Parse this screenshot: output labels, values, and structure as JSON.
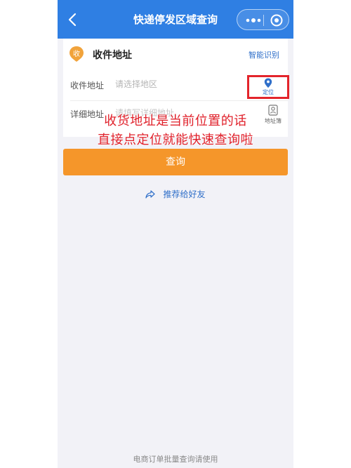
{
  "header": {
    "title": "快递停发区域查询",
    "back_icon": "chevron-left-icon",
    "more_icon": "more-dots-icon",
    "close_icon": "target-close-icon",
    "bg_color": "#2f7fe3"
  },
  "address_card": {
    "badge": "收",
    "title": "收件地址",
    "smart_id_label": "智能识别",
    "region": {
      "label": "收件地址",
      "placeholder": "请选择地区"
    },
    "locate": {
      "label": "定位",
      "icon": "location-pin-icon"
    },
    "detail": {
      "label": "详细地址",
      "placeholder": "请填写详细地址"
    },
    "address_book": {
      "label": "地址簿",
      "icon": "contact-book-icon"
    }
  },
  "annotation": {
    "line1": "收货地址是当前位置的话",
    "line2": "直接点定位就能快速查询啦",
    "color": "#e0202a"
  },
  "actions": {
    "query_label": "查询",
    "share_label": "推荐给好友",
    "share_icon": "share-arrow-icon",
    "accent_color": "#f5962a"
  },
  "footer": {
    "text": "电商订单批量查询请使用"
  }
}
